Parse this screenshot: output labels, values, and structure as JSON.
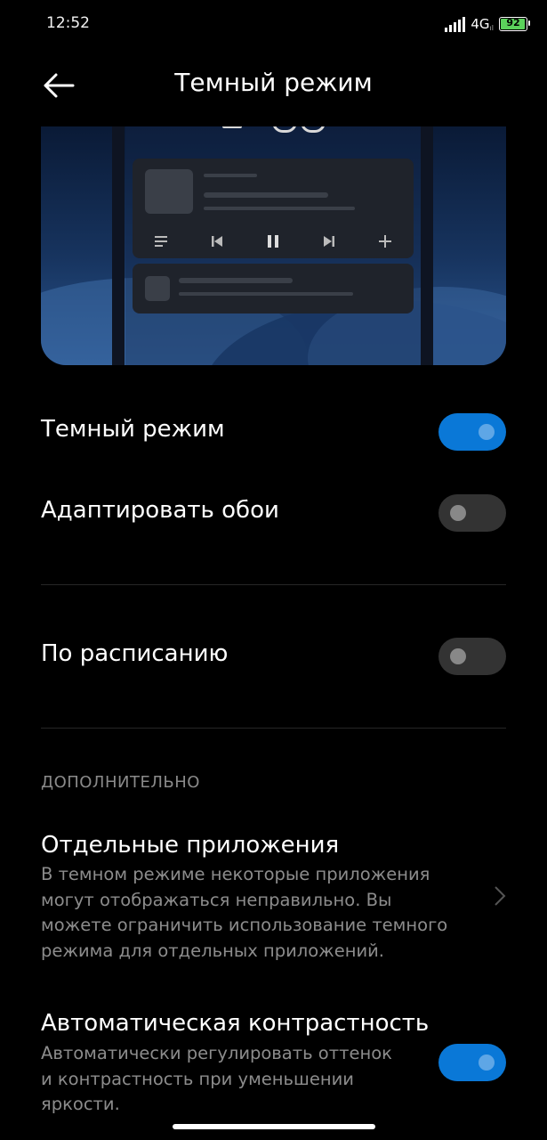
{
  "status_bar": {
    "time": "12:52",
    "network": "4G",
    "network_sub": "ıl",
    "battery": "92",
    "battery_color": "#5bd25b"
  },
  "header": {
    "title": "Темный режим",
    "back_icon": "arrow-left-icon"
  },
  "preview": {
    "player_icons": [
      "playlist-icon",
      "previous-icon",
      "pause-icon",
      "next-icon",
      "add-icon"
    ]
  },
  "settings": {
    "dark_mode": {
      "label": "Темный режим",
      "enabled": true
    },
    "adapt_wallpaper": {
      "label": "Адаптировать обои",
      "enabled": false
    },
    "schedule": {
      "label": "По расписанию",
      "enabled": false
    }
  },
  "additional": {
    "section_title": "ДОПОЛНИТЕЛЬНО",
    "separate_apps": {
      "title": "Отдельные приложения",
      "desc_lines": [
        "В темном режиме некоторые приложения",
        "могут отображаться неправильно. Вы",
        "можете ограничить использование темного",
        "режима для отдельных приложений."
      ]
    },
    "auto_contrast": {
      "title": "Автоматическая контрастность",
      "desc_lines": [
        "Автоматически регулировать оттенок",
        "и контрастность при уменьшении",
        "яркости."
      ],
      "enabled": true
    }
  },
  "colors": {
    "accent": "#0a78d7",
    "toggle_off": "#333333",
    "background": "#000000"
  }
}
